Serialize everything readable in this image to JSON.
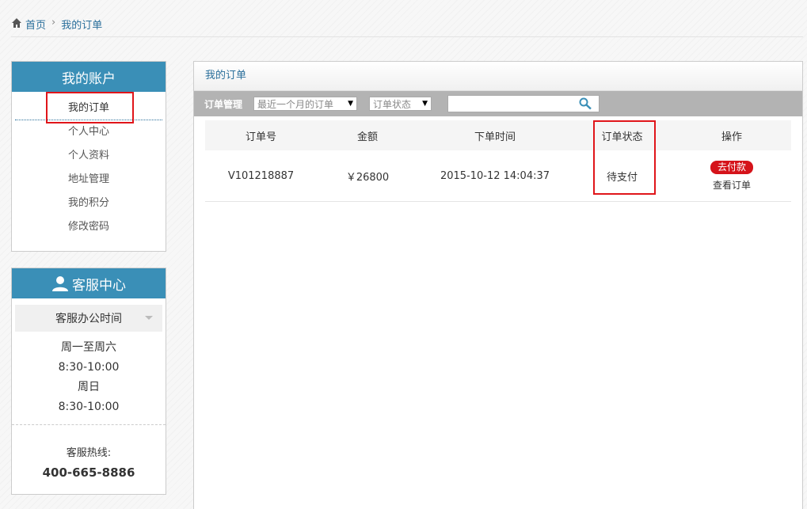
{
  "breadcrumb": {
    "home": "首页",
    "current": "我的订单"
  },
  "account": {
    "title": "我的账户",
    "items": [
      "我的订单",
      "个人中心",
      "个人资料",
      "地址管理",
      "我的积分",
      "修改密码"
    ]
  },
  "service": {
    "title": "客服中心",
    "hours_title": "客服办公时间",
    "hours": [
      "周一至周六",
      "8:30-10:00",
      "周日",
      "8:30-10:00"
    ],
    "hotline_label": "客服热线:",
    "hotline": "400-665-8886"
  },
  "main": {
    "title": "我的订单",
    "filter_label": "订单管理",
    "time_select": "最近一个月的订单",
    "status_select": "订单状态",
    "search_value": ""
  },
  "table": {
    "headers": [
      "订单号",
      "金额",
      "下单时间",
      "订单状态",
      "操作"
    ],
    "rows": [
      {
        "order_no": "V101218887",
        "amount": "￥26800",
        "time": "2015-10-12 14:04:37",
        "status": "待支付",
        "pay_label": "去付款",
        "view_label": "查看订单"
      }
    ]
  },
  "colors": {
    "accent": "#3a8fb7",
    "link": "#2a6f9b",
    "danger": "#d5131a",
    "highlight": "#e0151a"
  }
}
